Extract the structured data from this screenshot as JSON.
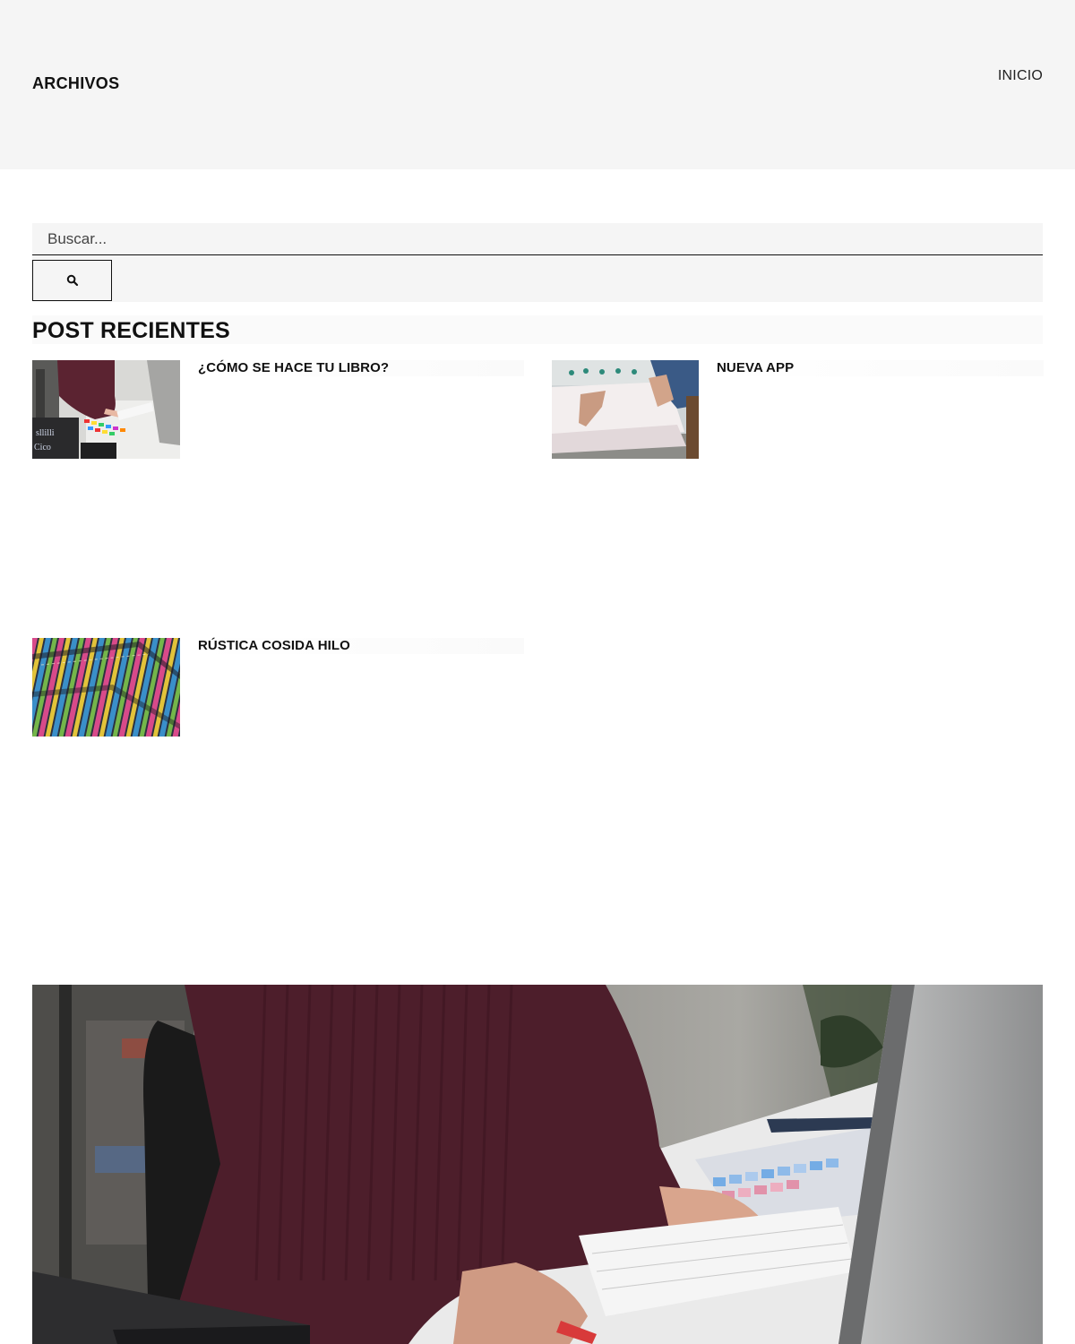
{
  "header": {
    "title": "ARCHIVOS",
    "nav": [
      {
        "label": "INICIO"
      }
    ]
  },
  "search": {
    "placeholder": "Buscar...",
    "button_icon": "search-icon"
  },
  "recent_posts": {
    "heading": "POST RECIENTES",
    "items": [
      {
        "title": "¿CÓMO SE HACE TU LIBRO?",
        "thumbnail": "person-at-computer-image"
      },
      {
        "title": "NUEVA APP",
        "thumbnail": "paper-stack-cutter-image"
      },
      {
        "title": "RÚSTICA COSIDA HILO",
        "thumbnail": "colored-book-spines-image"
      }
    ]
  },
  "featured_image": {
    "image": "person-typing-at-desk-image"
  },
  "colors": {
    "header_background": "#f5f5f5",
    "text": "#111111",
    "page_background": "#ffffff"
  }
}
